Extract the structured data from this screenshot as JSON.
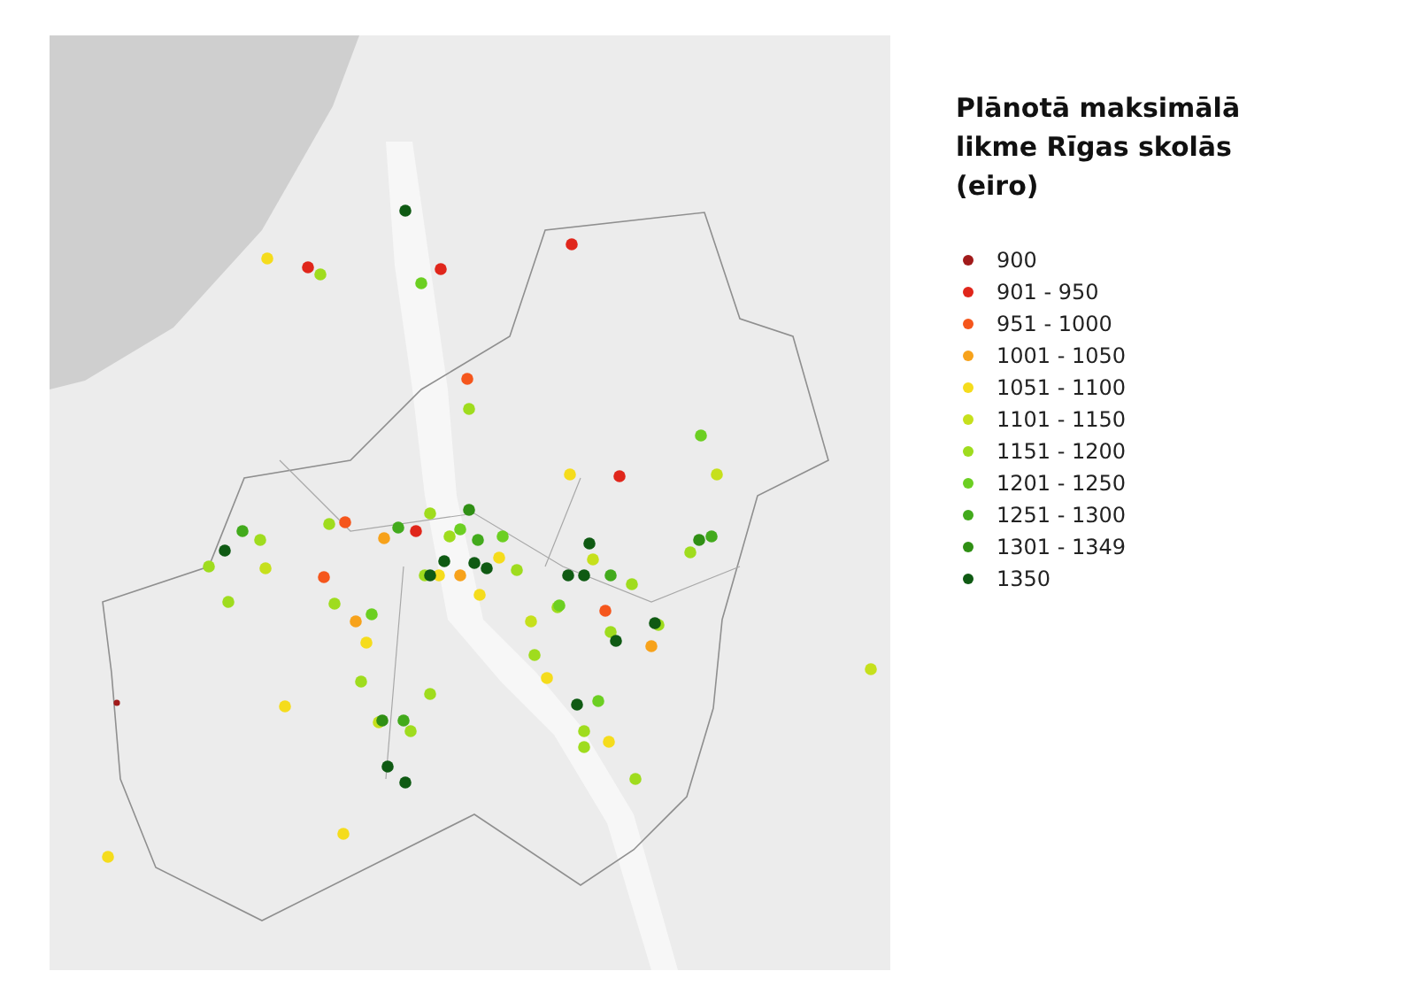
{
  "legend": {
    "title": "Plānotā maksimālā likme Rīgas skolās (eiro)",
    "items": [
      {
        "label": "900",
        "color": "#a11a1a"
      },
      {
        "label": "901 - 950",
        "color": "#e0261b"
      },
      {
        "label": "951 - 1000",
        "color": "#f5561c"
      },
      {
        "label": "1001 - 1050",
        "color": "#f7a21b"
      },
      {
        "label": "1051 - 1100",
        "color": "#f5dc1c"
      },
      {
        "label": "1101 - 1150",
        "color": "#c6e01c"
      },
      {
        "label": "1151 - 1200",
        "color": "#9fdc1e"
      },
      {
        "label": "1201 - 1250",
        "color": "#6ccf22"
      },
      {
        "label": "1251 - 1300",
        "color": "#42aa1c"
      },
      {
        "label": "1301 - 1349",
        "color": "#2f8f14"
      },
      {
        "label": "1350",
        "color": "#0f5a13"
      }
    ]
  }
}
